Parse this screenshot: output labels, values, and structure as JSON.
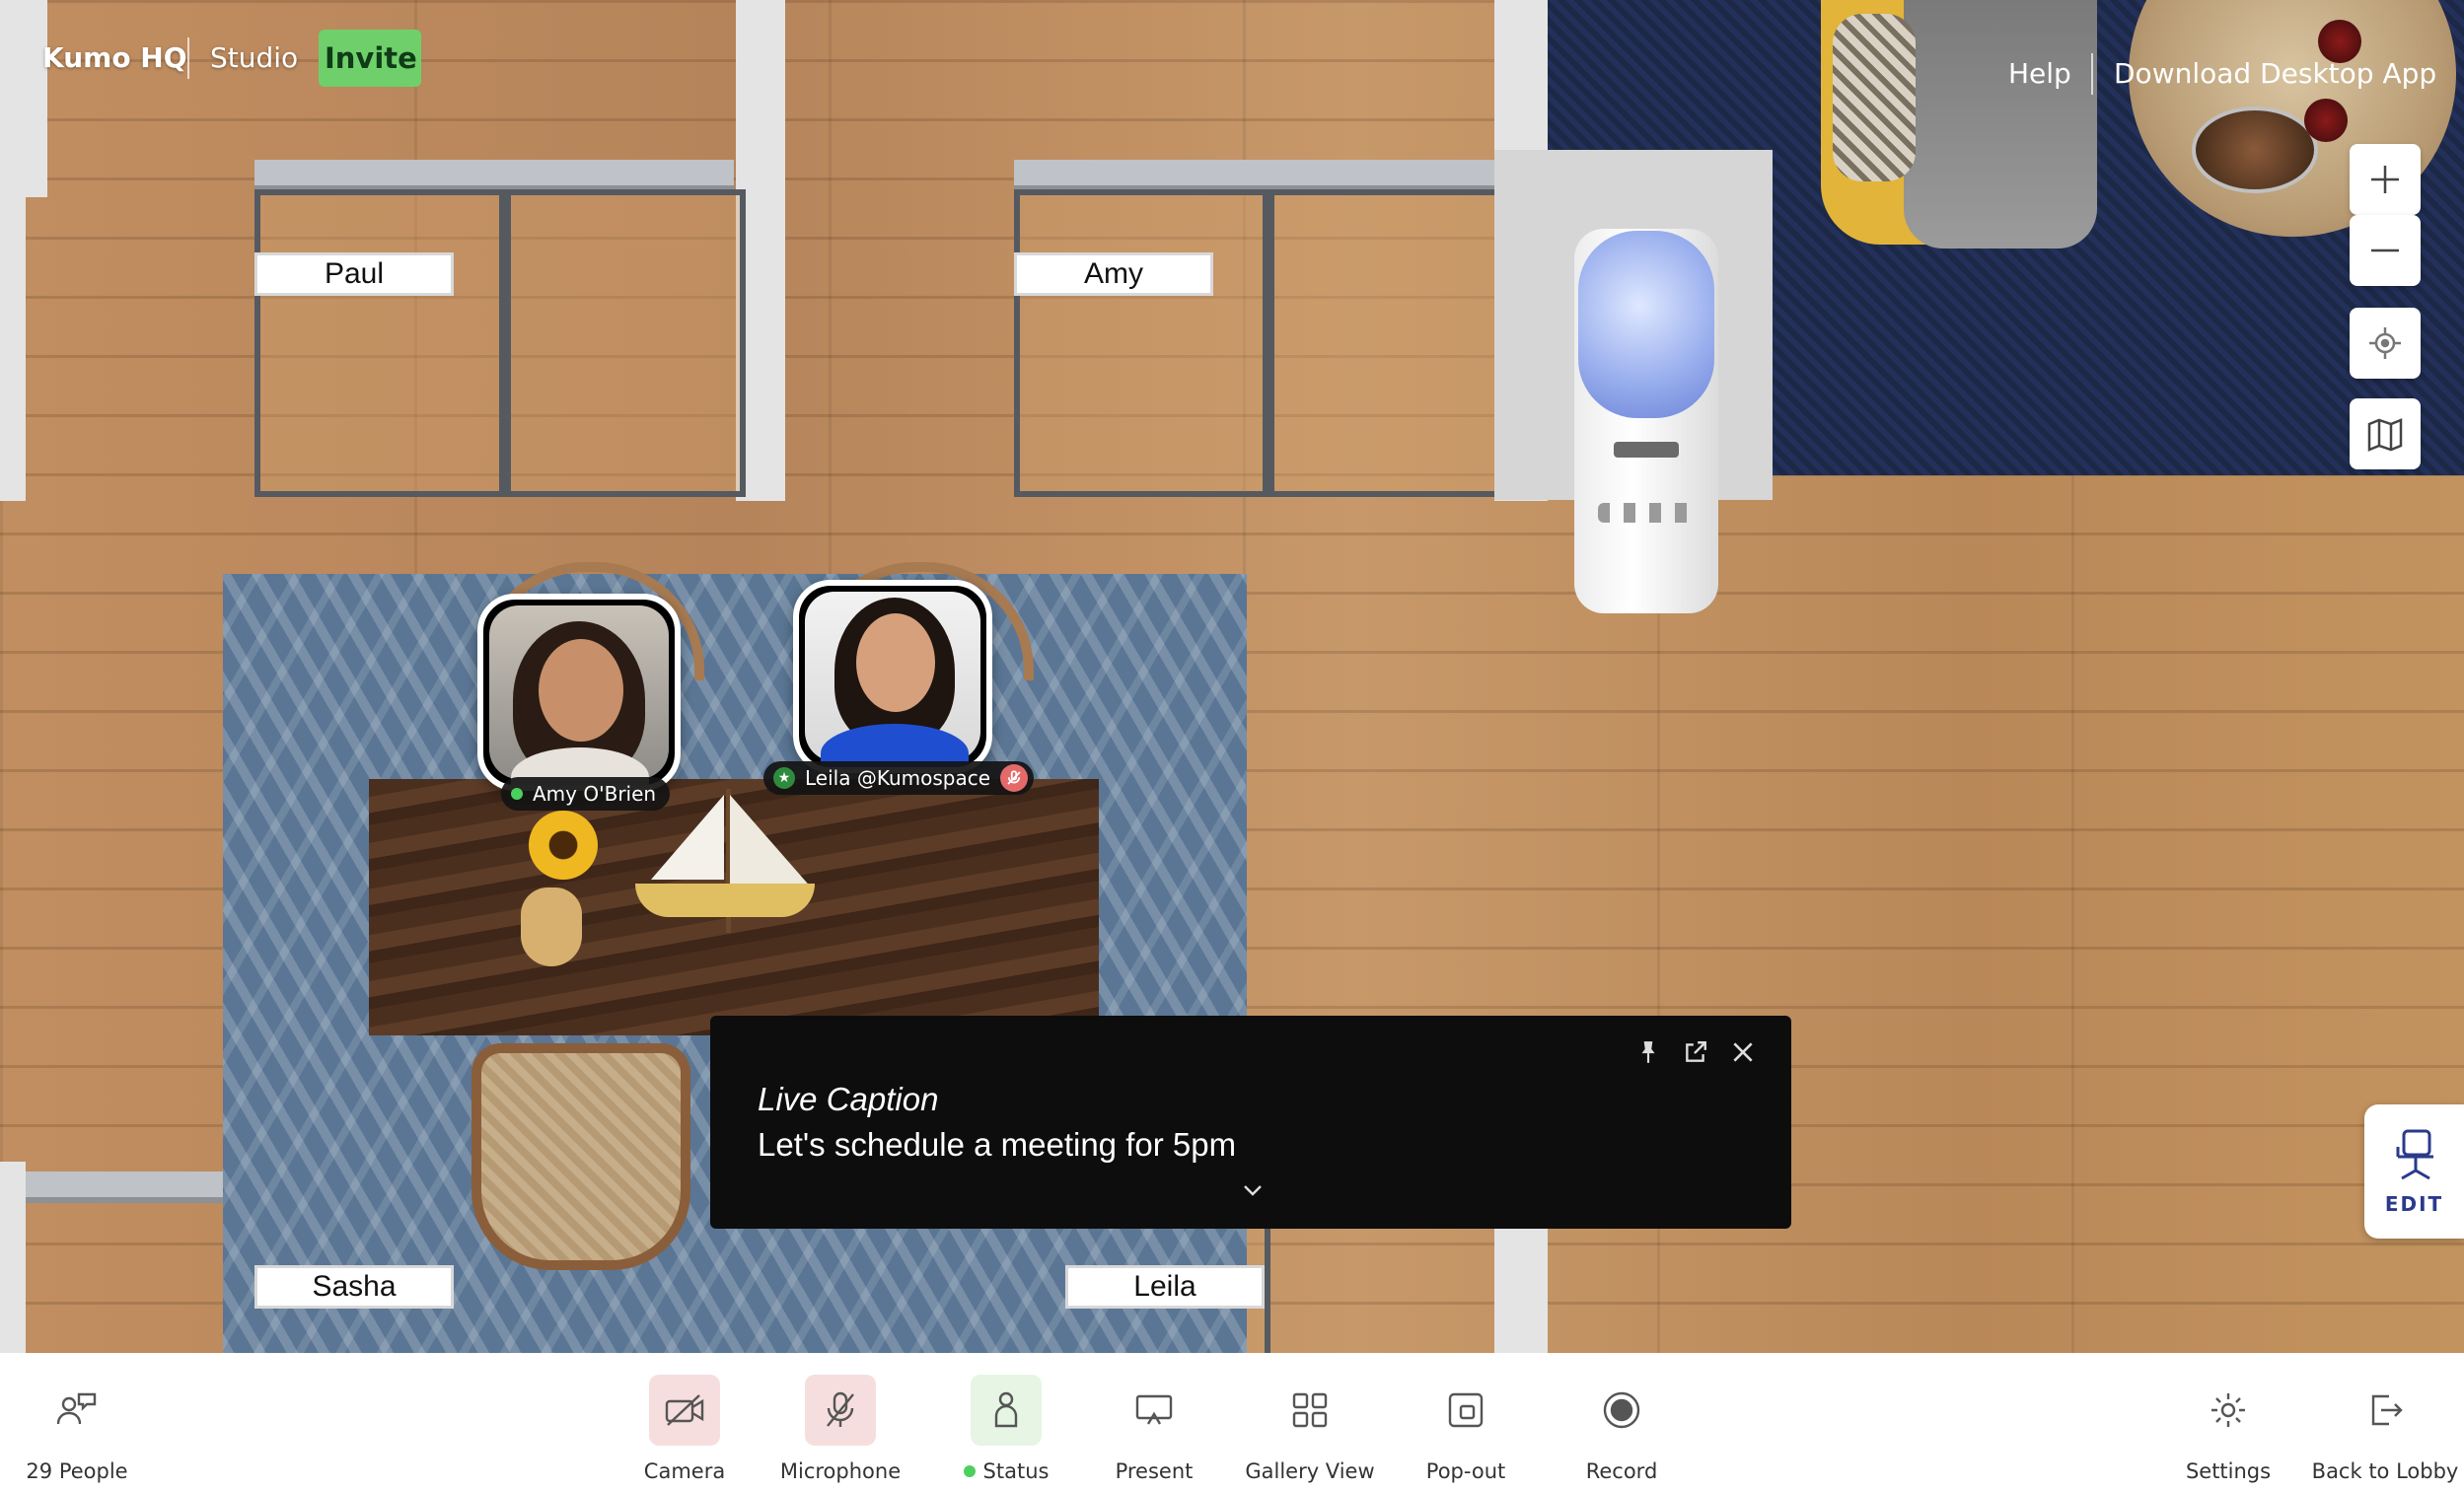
{
  "header": {
    "brand": "Kumo HQ",
    "studio": "Studio",
    "invite": "Invite",
    "help": "Help",
    "download": "Download Desktop App"
  },
  "room": {
    "nameplates": [
      "Paul",
      "Amy",
      "Sasha",
      "Leila"
    ]
  },
  "participants": [
    {
      "name": "Amy O'Brien",
      "status": "online"
    },
    {
      "name": "Leila @Kumospace",
      "status": "muted"
    }
  ],
  "caption": {
    "title": "Live Caption",
    "text": "Let's schedule a meeting for 5pm"
  },
  "controls": {
    "edit": "EDIT",
    "icons": [
      "zoom-in-icon",
      "zoom-out-icon",
      "locate-icon",
      "map-icon"
    ]
  },
  "toolbar": {
    "people": "29 People",
    "camera": "Camera",
    "microphone": "Microphone",
    "status": "Status",
    "present": "Present",
    "gallery": "Gallery View",
    "popout": "Pop-out",
    "record": "Record",
    "settings": "Settings",
    "back": "Back to Lobby"
  },
  "colors": {
    "invite_bg": "#6fd06b",
    "muted_red": "#f7dede",
    "status_green": "#4bd05e",
    "caption_bg": "#0d0d0d"
  }
}
